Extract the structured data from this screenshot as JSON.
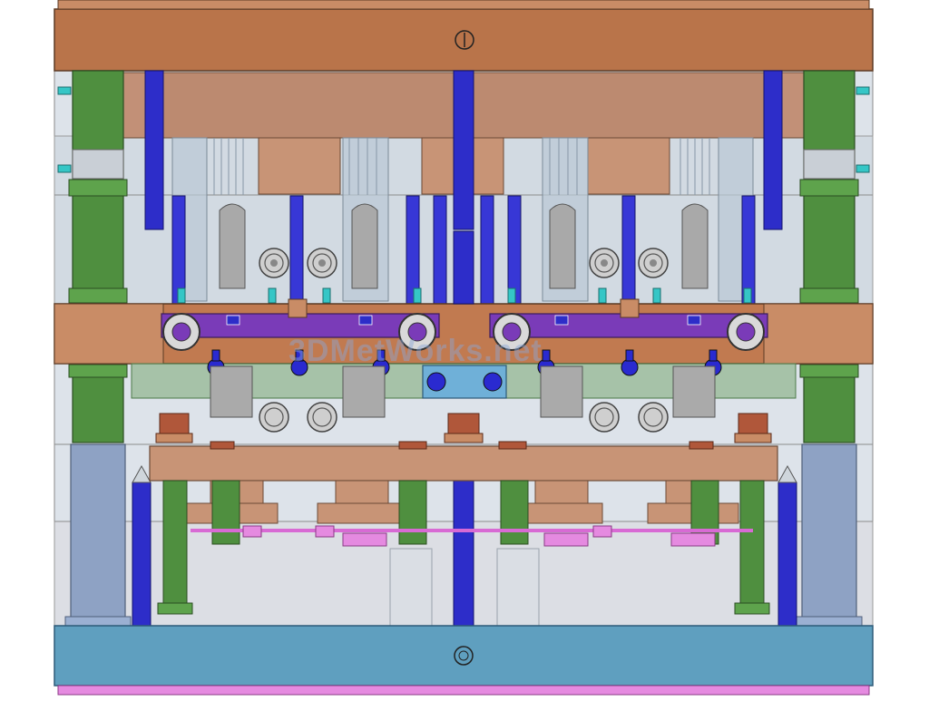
{
  "watermark": "3DMetWorks.net",
  "colors": {
    "plate_copper": "#b9744a",
    "plate_copper_light": "#c98c66",
    "plate_blue": "#5f9fbf",
    "plate_pink": "#e58ae0",
    "pillar_green": "#4f8f3f",
    "pin_blue": "#2d2dc9",
    "slider_purple": "#7a3bb8",
    "cylinder_grey": "#a9a9a9",
    "glass_grey": "#c9d3dc",
    "accent_cyan": "#35c6c6",
    "line_dark": "#333333"
  }
}
